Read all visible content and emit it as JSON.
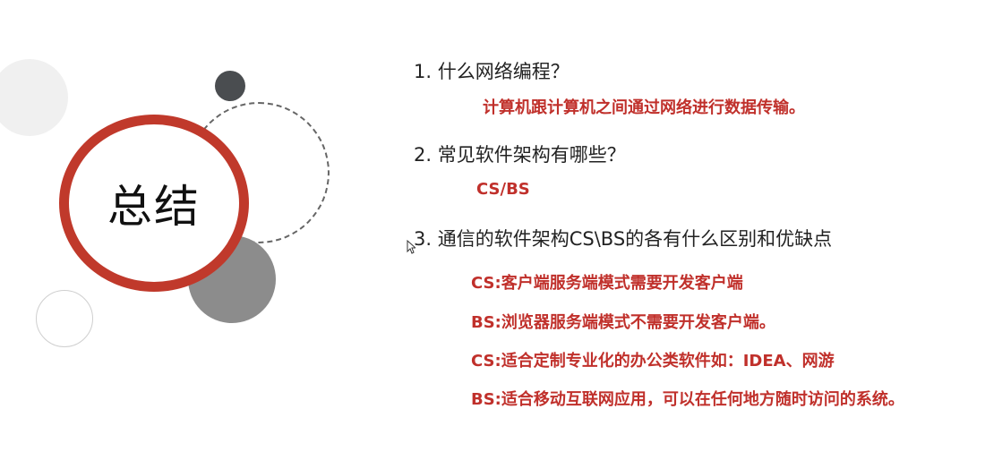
{
  "summary_title": "总结",
  "items": [
    {
      "question": "1.  什么网络编程？",
      "answers": [
        "计算机跟计算机之间通过网络进行数据传输。"
      ]
    },
    {
      "question": "2.  常见软件架构有哪些？",
      "answers": [
        "CS/BS"
      ]
    },
    {
      "question": "3.  通信的软件架构CS\\BS的各有什么区别和优缺点",
      "answers": [
        "CS:客户端服务端模式需要开发客户端",
        "BS:浏览器服务端模式不需要开发客户端。",
        "CS:适合定制专业化的办公类软件如：IDEA、网游",
        "BS:适合移动互联网应用，可以在任何地方随时访问的系统。"
      ]
    }
  ],
  "colors": {
    "accent_red": "#c0392b",
    "answer_red": "#c0302b",
    "dark_circle": "#4a4d50",
    "gray_circle": "#8c8c8c"
  }
}
